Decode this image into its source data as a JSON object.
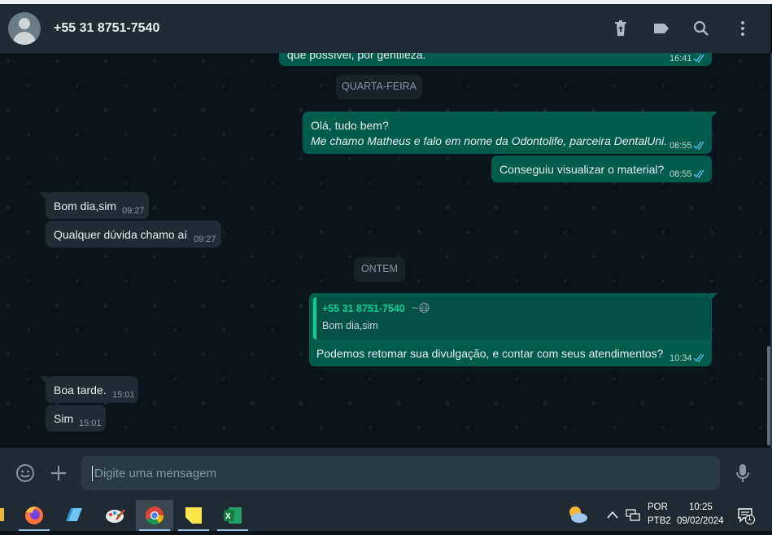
{
  "header": {
    "contact_name": "+55 31 8751-7540",
    "icons": [
      "trash-icon",
      "label-icon",
      "search-icon",
      "menu-icon"
    ]
  },
  "chat": {
    "top_partial": {
      "text": "que possível, por gentileza.",
      "time": "16:41"
    },
    "day_wed": "QUARTA-FEIRA",
    "msg1": {
      "line1": "Olá, tudo bem?",
      "line2": "Me chamo Matheus e falo em nome da Odontolife, parceira DentalUni.",
      "time": "08:55"
    },
    "msg2": {
      "text": "Conseguiu visualizar o material?",
      "time": "08:55"
    },
    "in1": {
      "text": "Bom dia,sim",
      "time": "09:27"
    },
    "in2": {
      "text": "Qualquer dúvida chamo aí",
      "time": "09:27"
    },
    "day_yesterday": "ONTEM",
    "reply": {
      "quoted_author": "+55 31 8751-7540",
      "quoted_suffix": "~😷",
      "quoted_text": "Bom dia,sim",
      "text": "Podemos retomar sua divulgação, e contar com seus atendimentos?",
      "time": "10:34"
    },
    "in3": {
      "text": "Boa tarde.",
      "time": "15:01"
    },
    "in4": {
      "text": "Sim",
      "time": "15:01"
    }
  },
  "composer": {
    "placeholder": "Digite uma mensagem",
    "icons": [
      "emoji-icon",
      "plus-icon",
      "mic-icon"
    ]
  },
  "taskbar": {
    "apps": [
      "firefox-icon",
      "notepad-icon",
      "paint-icon",
      "chrome-icon",
      "sticky-notes-icon",
      "excel-icon"
    ],
    "lang_top": "POR",
    "lang_bottom": "PTB2",
    "clock_time": "10:25",
    "clock_date": "09/02/2024",
    "notification_count": "1"
  }
}
